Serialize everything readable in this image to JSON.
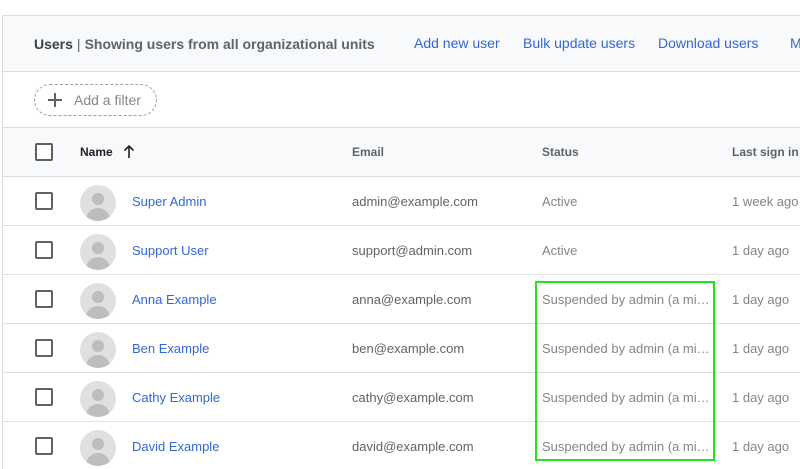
{
  "header": {
    "title": "Users",
    "separator": "|",
    "subtitle": "Showing users from all organizational units",
    "actions": [
      "Add new user",
      "Bulk update users",
      "Download users",
      "M"
    ]
  },
  "filter": {
    "label": "Add a filter",
    "icon": "plus-icon"
  },
  "table": {
    "columns": {
      "name": "Name",
      "email": "Email",
      "status": "Status",
      "last_sign_in": "Last sign in"
    },
    "sort_icon": "arrow-up-icon",
    "rows": [
      {
        "name": "Super Admin",
        "email": "admin@example.com",
        "status": "Active",
        "last_sign_in": "1 week ago"
      },
      {
        "name": "Support User",
        "email": "support@admin.com",
        "status": "Active",
        "last_sign_in": "1 day ago"
      },
      {
        "name": "Anna Example",
        "email": "anna@example.com",
        "status": "Suspended by admin (a minute ago)",
        "last_sign_in": "1 day ago"
      },
      {
        "name": "Ben Example",
        "email": "ben@example.com",
        "status": "Suspended by admin (a minute ago)",
        "last_sign_in": "1 day ago"
      },
      {
        "name": "Cathy Example",
        "email": "cathy@example.com",
        "status": "Suspended by admin (a minute ago)",
        "last_sign_in": "1 day ago"
      },
      {
        "name": "David Example",
        "email": "david@example.com",
        "status": "Suspended by admin (a minute ago)",
        "last_sign_in": "1 day ago"
      }
    ]
  },
  "colors": {
    "link": "#3367d6",
    "highlight": "#22e322",
    "header_bg": "#f8f9fa"
  }
}
